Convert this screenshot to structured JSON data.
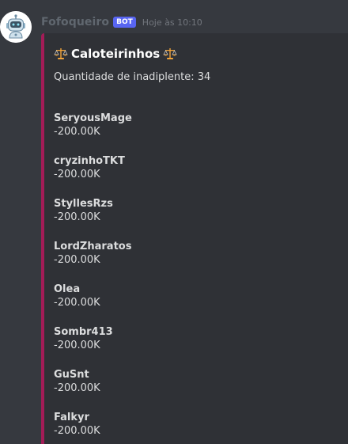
{
  "message": {
    "author": "Fofoqueiro",
    "bot_tag": "BOT",
    "timestamp": "Hoje às 10:10",
    "avatar_icon": "robot-avatar-icon"
  },
  "embed": {
    "accent_color": "#a31c57",
    "title": "Caloteirinhos",
    "title_icon": "balance-scale-icon",
    "description": "Quantidade de inadiplente: 34",
    "fields": [
      {
        "name": "SeryousMage",
        "value": "-200.00K"
      },
      {
        "name": "cryzinhoTKT",
        "value": "-200.00K"
      },
      {
        "name": "StyllesRzs",
        "value": "-200.00K"
      },
      {
        "name": "LordZharatos",
        "value": "-200.00K"
      },
      {
        "name": "Olea",
        "value": "-200.00K"
      },
      {
        "name": "Sombr413",
        "value": "-200.00K"
      },
      {
        "name": "GuSnt",
        "value": "-200.00K"
      },
      {
        "name": "Falkyr",
        "value": "-200.00K"
      }
    ]
  }
}
